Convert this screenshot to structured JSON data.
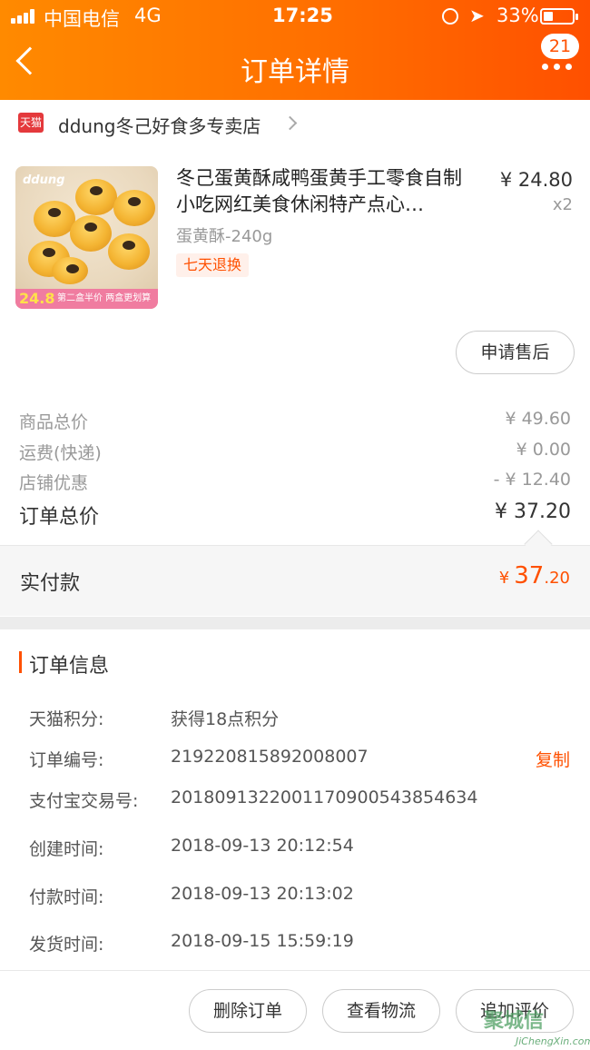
{
  "status_bar": {
    "carrier": "中国电信",
    "network": "4G",
    "time": "17:25",
    "battery_percent": "33%",
    "battery_level": 0.33
  },
  "nav": {
    "title": "订单详情",
    "badge_count": "21"
  },
  "shop": {
    "platform_badge": "天猫",
    "name": "ddung冬己好食多专卖店"
  },
  "product": {
    "title": "冬己蛋黄酥咸鸭蛋黄手工零食自制小吃网红美食休闲特产点心…",
    "price": "¥ 24.80",
    "quantity": "x2",
    "sku": "蛋黄酥-240g",
    "tag": "七天退换",
    "image_text": {
      "logo": "ddung",
      "promo": "第二盒半价 两盒更划算",
      "price": "24.8"
    }
  },
  "after_sale_button": "申请售后",
  "fees": [
    {
      "label": "商品总价",
      "value": "¥ 49.60"
    },
    {
      "label": "运费(快递)",
      "value": "¥ 0.00"
    },
    {
      "label": "店铺优惠",
      "value": "- ¥ 12.40"
    }
  ],
  "total": {
    "label": "订单总价",
    "value": "¥ 37.20"
  },
  "paid": {
    "label": "实付款",
    "currency": "¥",
    "int": "37",
    "dec": ".20"
  },
  "order_info": {
    "title": "订单信息",
    "rows": [
      {
        "key": "天猫积分:",
        "value": "获得18点积分"
      },
      {
        "key": "订单编号:",
        "value": "219220815892008007",
        "action": "复制"
      },
      {
        "key": "支付宝交易号:",
        "value": "2018091322001170900543854634"
      },
      {
        "key": "创建时间:",
        "value": "2018-09-13 20:12:54"
      },
      {
        "key": "付款时间:",
        "value": "2018-09-13 20:13:02"
      },
      {
        "key": "发货时间:",
        "value": "2018-09-15 15:59:19"
      }
    ]
  },
  "actions": {
    "delete": "删除订单",
    "logistics": "查看物流",
    "review": "追加评价"
  },
  "watermark": {
    "main": "聚城信",
    "sub": "JiChengXin.com"
  },
  "colors": {
    "accent": "#ff5000",
    "header_start": "#ff8a00"
  },
  "icons": [
    "back-icon",
    "more-icon",
    "lock-rotation-icon",
    "location-icon",
    "battery-icon",
    "chevron-right-icon"
  ]
}
